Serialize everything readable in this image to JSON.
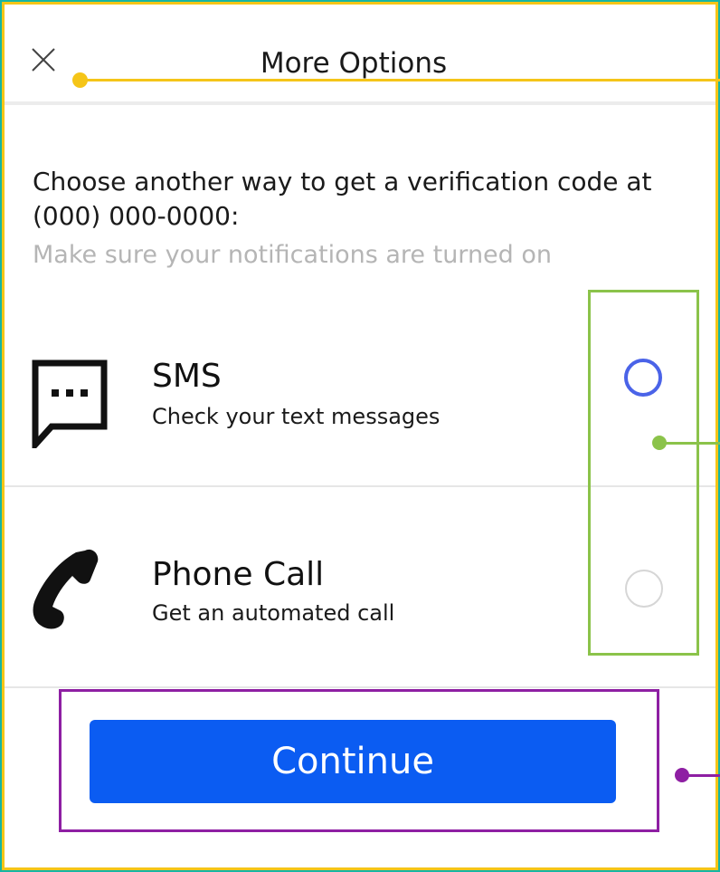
{
  "header": {
    "title": "More Options",
    "close_icon": "close-icon"
  },
  "prompt": {
    "text": "Choose another way to get a verification code at (000) 000-0000:",
    "hint": "Make sure your notifications are turned on"
  },
  "options": [
    {
      "title": "SMS",
      "subtitle": "Check your text messages",
      "icon": "sms-chat-bubble-icon",
      "selected": true
    },
    {
      "title": "Phone Call",
      "subtitle": "Get an automated call",
      "icon": "phone-icon",
      "selected": false
    }
  ],
  "actions": {
    "continue_label": "Continue"
  },
  "colors": {
    "primary_button": "#0b5cf2",
    "selected_radio": "#4a63e8",
    "annotation_yellow": "#f5c518",
    "annotation_green": "#8bc34a",
    "annotation_purple": "#8e1fa3"
  }
}
